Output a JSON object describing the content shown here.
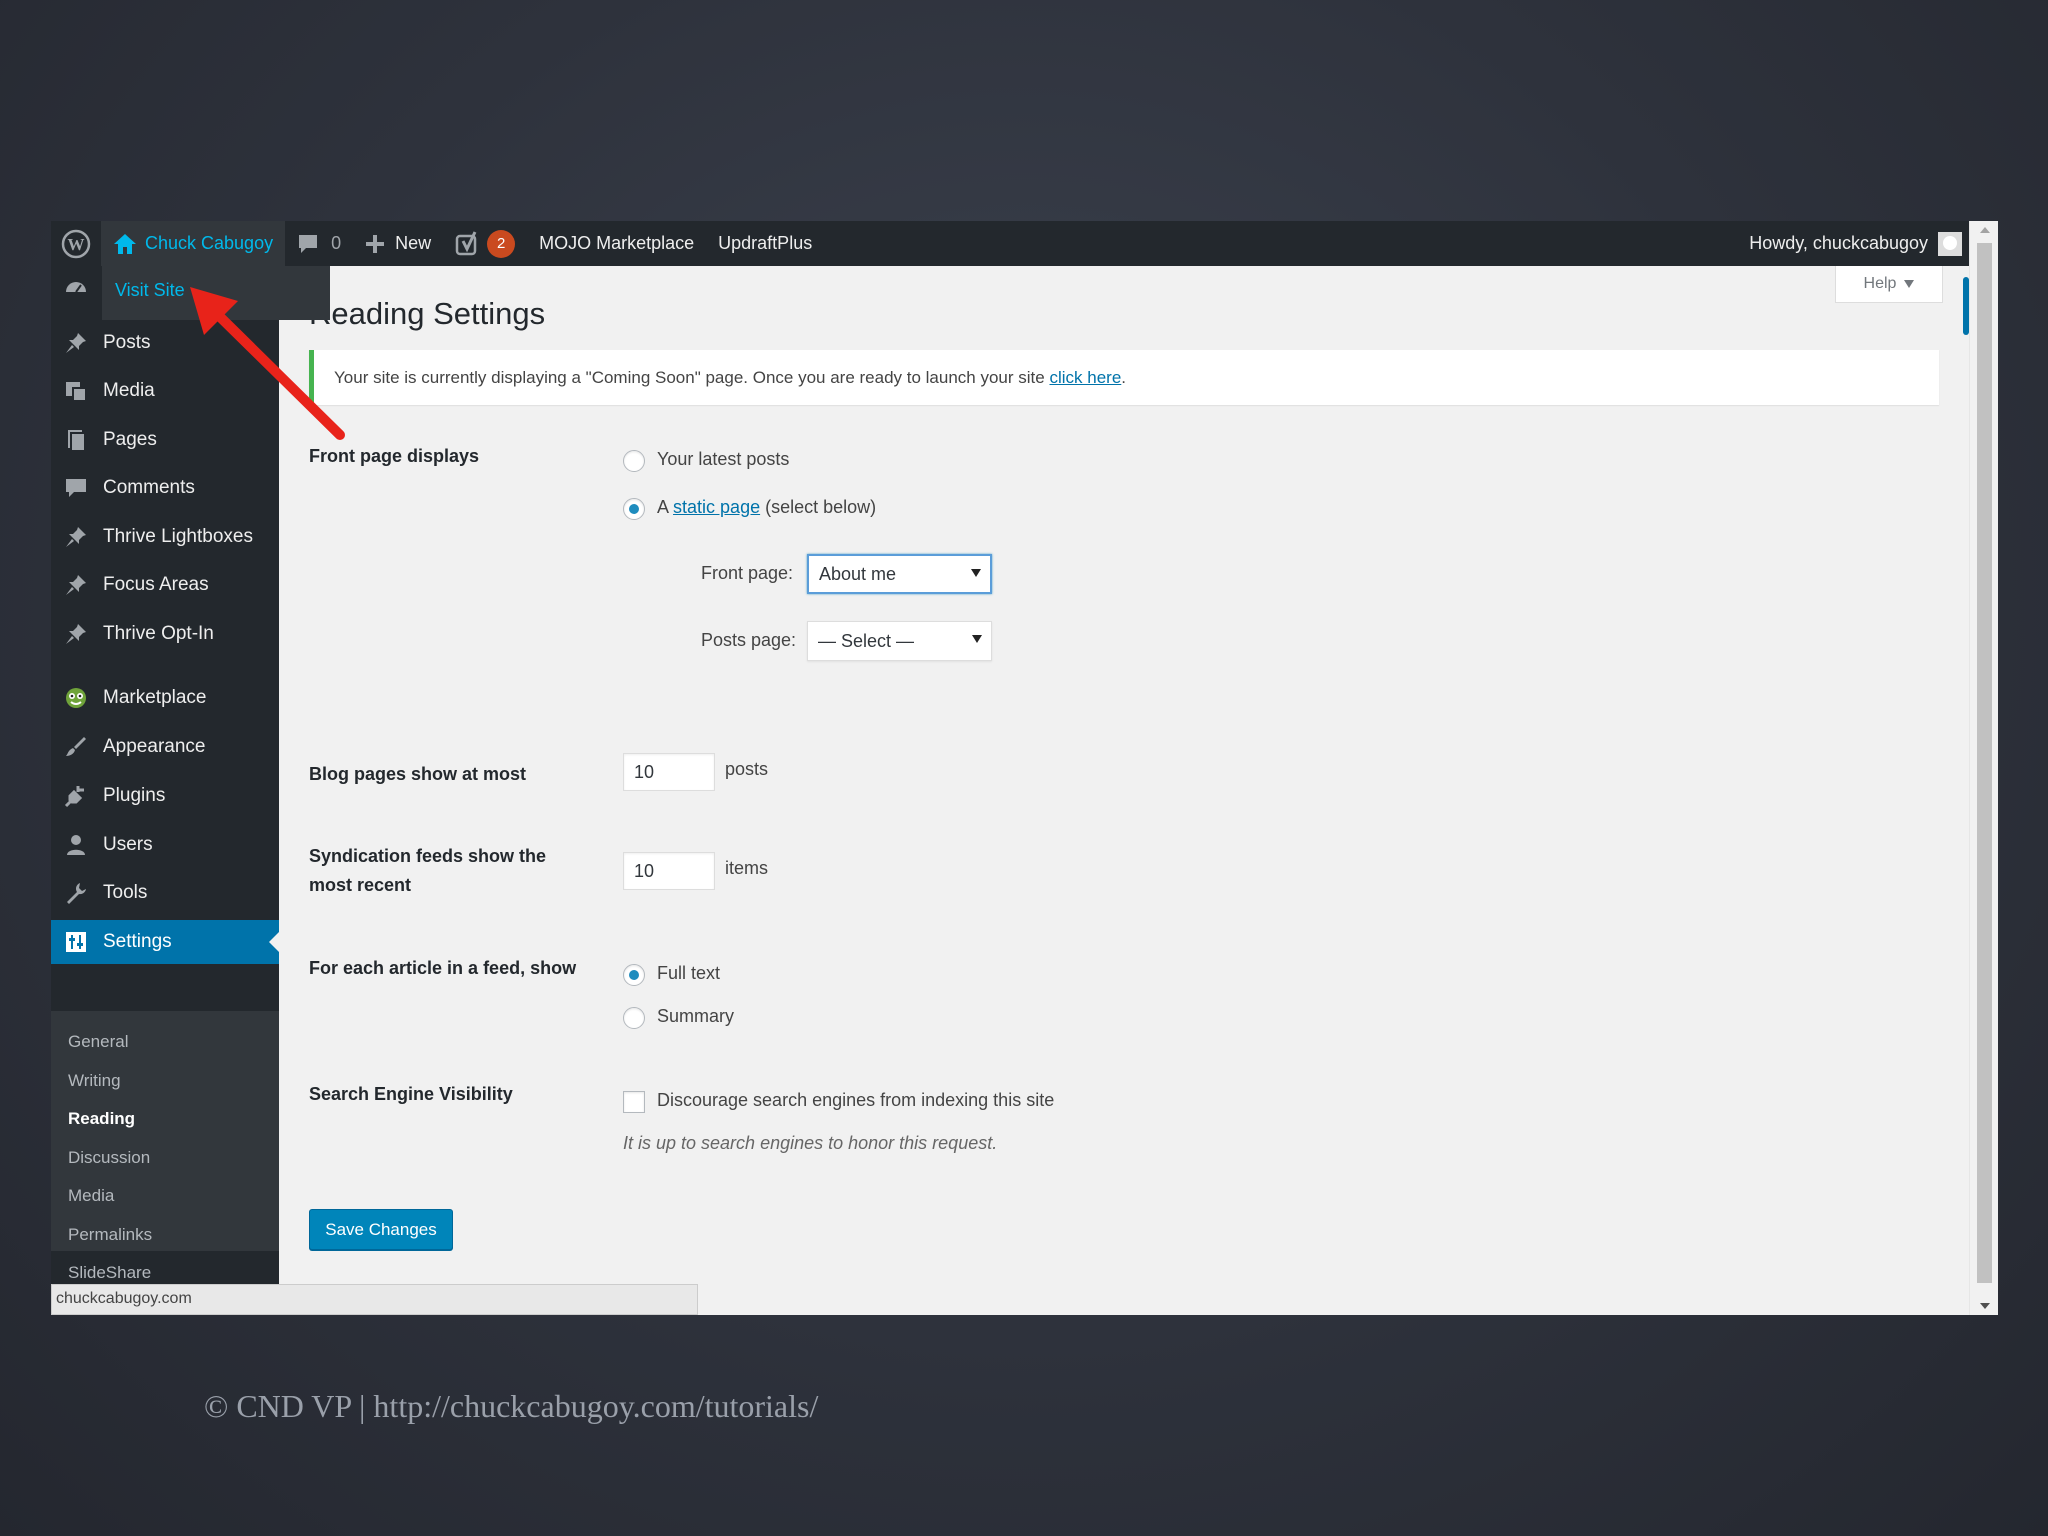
{
  "adminbar": {
    "site_name": "Chuck Cabugoy",
    "comments_count": "0",
    "new_label": "New",
    "yoast_badge": "2",
    "mojo_label": "MOJO Marketplace",
    "updraft_label": "UpdraftPlus",
    "howdy": "Howdy, chuckcabugoy"
  },
  "dropdown": {
    "visit_site": "Visit Site"
  },
  "sidebar": {
    "items": [
      {
        "label": "Posts",
        "icon": "pin-icon"
      },
      {
        "label": "Media",
        "icon": "media-icon"
      },
      {
        "label": "Pages",
        "icon": "pages-icon"
      },
      {
        "label": "Comments",
        "icon": "comments-icon"
      },
      {
        "label": "Thrive Lightboxes",
        "icon": "pin-icon"
      },
      {
        "label": "Focus Areas",
        "icon": "pin-icon"
      },
      {
        "label": "Thrive Opt-In",
        "icon": "pin-icon"
      },
      {
        "label": "Marketplace",
        "icon": "marketplace-icon"
      },
      {
        "label": "Appearance",
        "icon": "appearance-icon"
      },
      {
        "label": "Plugins",
        "icon": "plugins-icon"
      },
      {
        "label": "Users",
        "icon": "users-icon"
      },
      {
        "label": "Tools",
        "icon": "tools-icon"
      },
      {
        "label": "Settings",
        "icon": "settings-icon"
      }
    ],
    "submenu": [
      "General",
      "Writing",
      "Reading",
      "Discussion",
      "Media",
      "Permalinks",
      "SlideShare"
    ],
    "active_submenu": "Reading"
  },
  "content": {
    "help": "Help",
    "title": "Reading Settings",
    "notice_text": "Your site is currently displaying a \"Coming Soon\" page. Once you are ready to launch your site",
    "notice_link": "click here",
    "notice_end": ".",
    "front_page_label": "Front page displays",
    "opt_latest": "Your latest posts",
    "opt_static_prefix": "A",
    "opt_static_link": "static page",
    "opt_static_suffix": "(select below)",
    "front_page_select_label": "Front page:",
    "front_page_value": "About me",
    "posts_page_select_label": "Posts page:",
    "posts_page_value": "— Select —",
    "blog_pages_label": "Blog pages show at most",
    "blog_pages_value": "10",
    "blog_pages_unit": "posts",
    "syndication_label_1": "Syndication feeds show the",
    "syndication_label_2": "most recent",
    "syndication_value": "10",
    "syndication_unit": "items",
    "feed_article_label": "For each article in a feed, show",
    "feed_full": "Full text",
    "feed_summary": "Summary",
    "search_visibility_label": "Search Engine Visibility",
    "discourage_label": "Discourage search engines from indexing this site",
    "discourage_note": "It is up to search engines to honor this request.",
    "save_button": "Save Changes"
  },
  "statusbar": {
    "url": "chuckcabugoy.com"
  },
  "footer": {
    "text": "© CND VP | http://chuckcabugoy.com/tutorials/"
  },
  "colors": {
    "accent": "#0073aa",
    "adminbar": "#23282d",
    "annotation_arrow": "#e8231a",
    "notice_border": "#46b450"
  }
}
